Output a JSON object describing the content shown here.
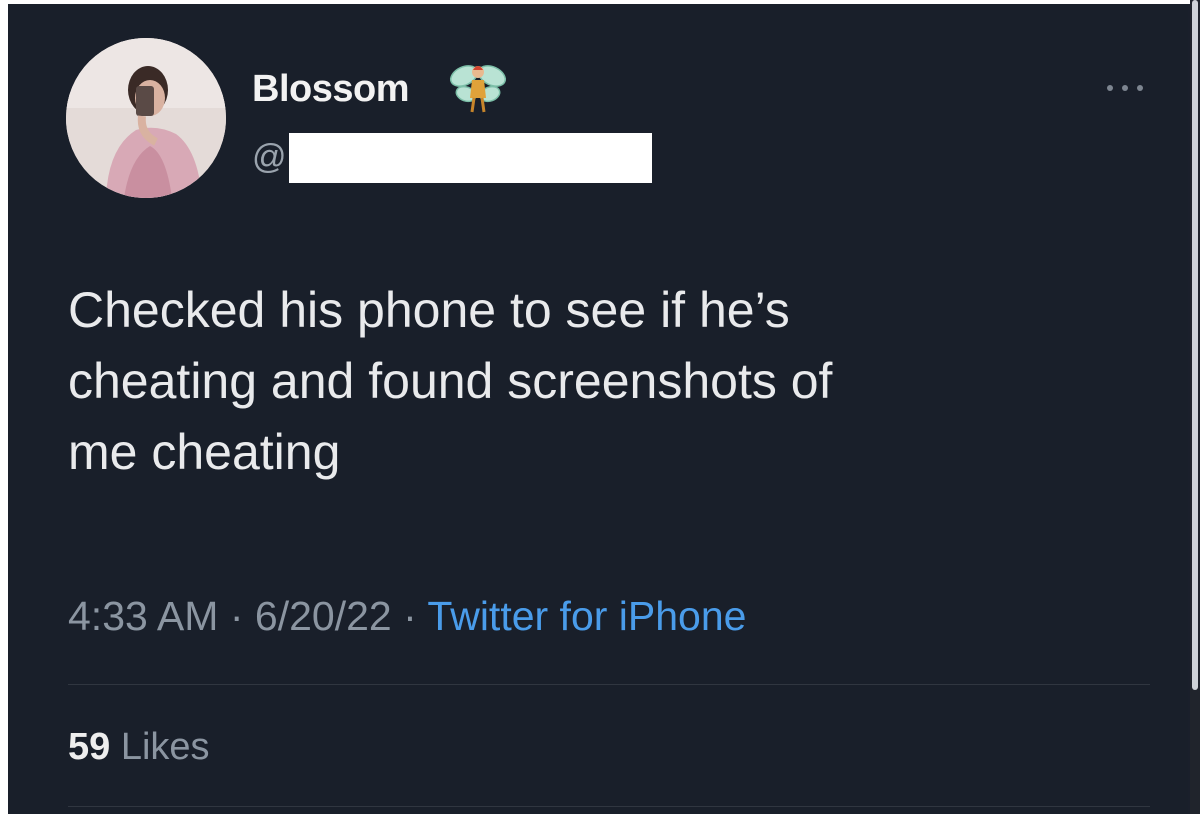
{
  "tweet": {
    "author": {
      "display_name": "Blossom",
      "handle_prefix": "@",
      "badge_emoji_icon": "fairy-icon"
    },
    "text_lines": [
      "Checked his phone to see if he’s",
      "cheating and found screenshots of",
      "me cheating"
    ],
    "meta": {
      "time": "4:33 AM",
      "separator": "·",
      "date": "6/20/22",
      "source": "Twitter for iPhone"
    },
    "likes": {
      "count": "59",
      "label": "Likes"
    }
  },
  "colors": {
    "background": "#191f2a",
    "link": "#4a9cea",
    "secondary_text": "#8b95a1",
    "primary_text": "#e9eaec"
  }
}
